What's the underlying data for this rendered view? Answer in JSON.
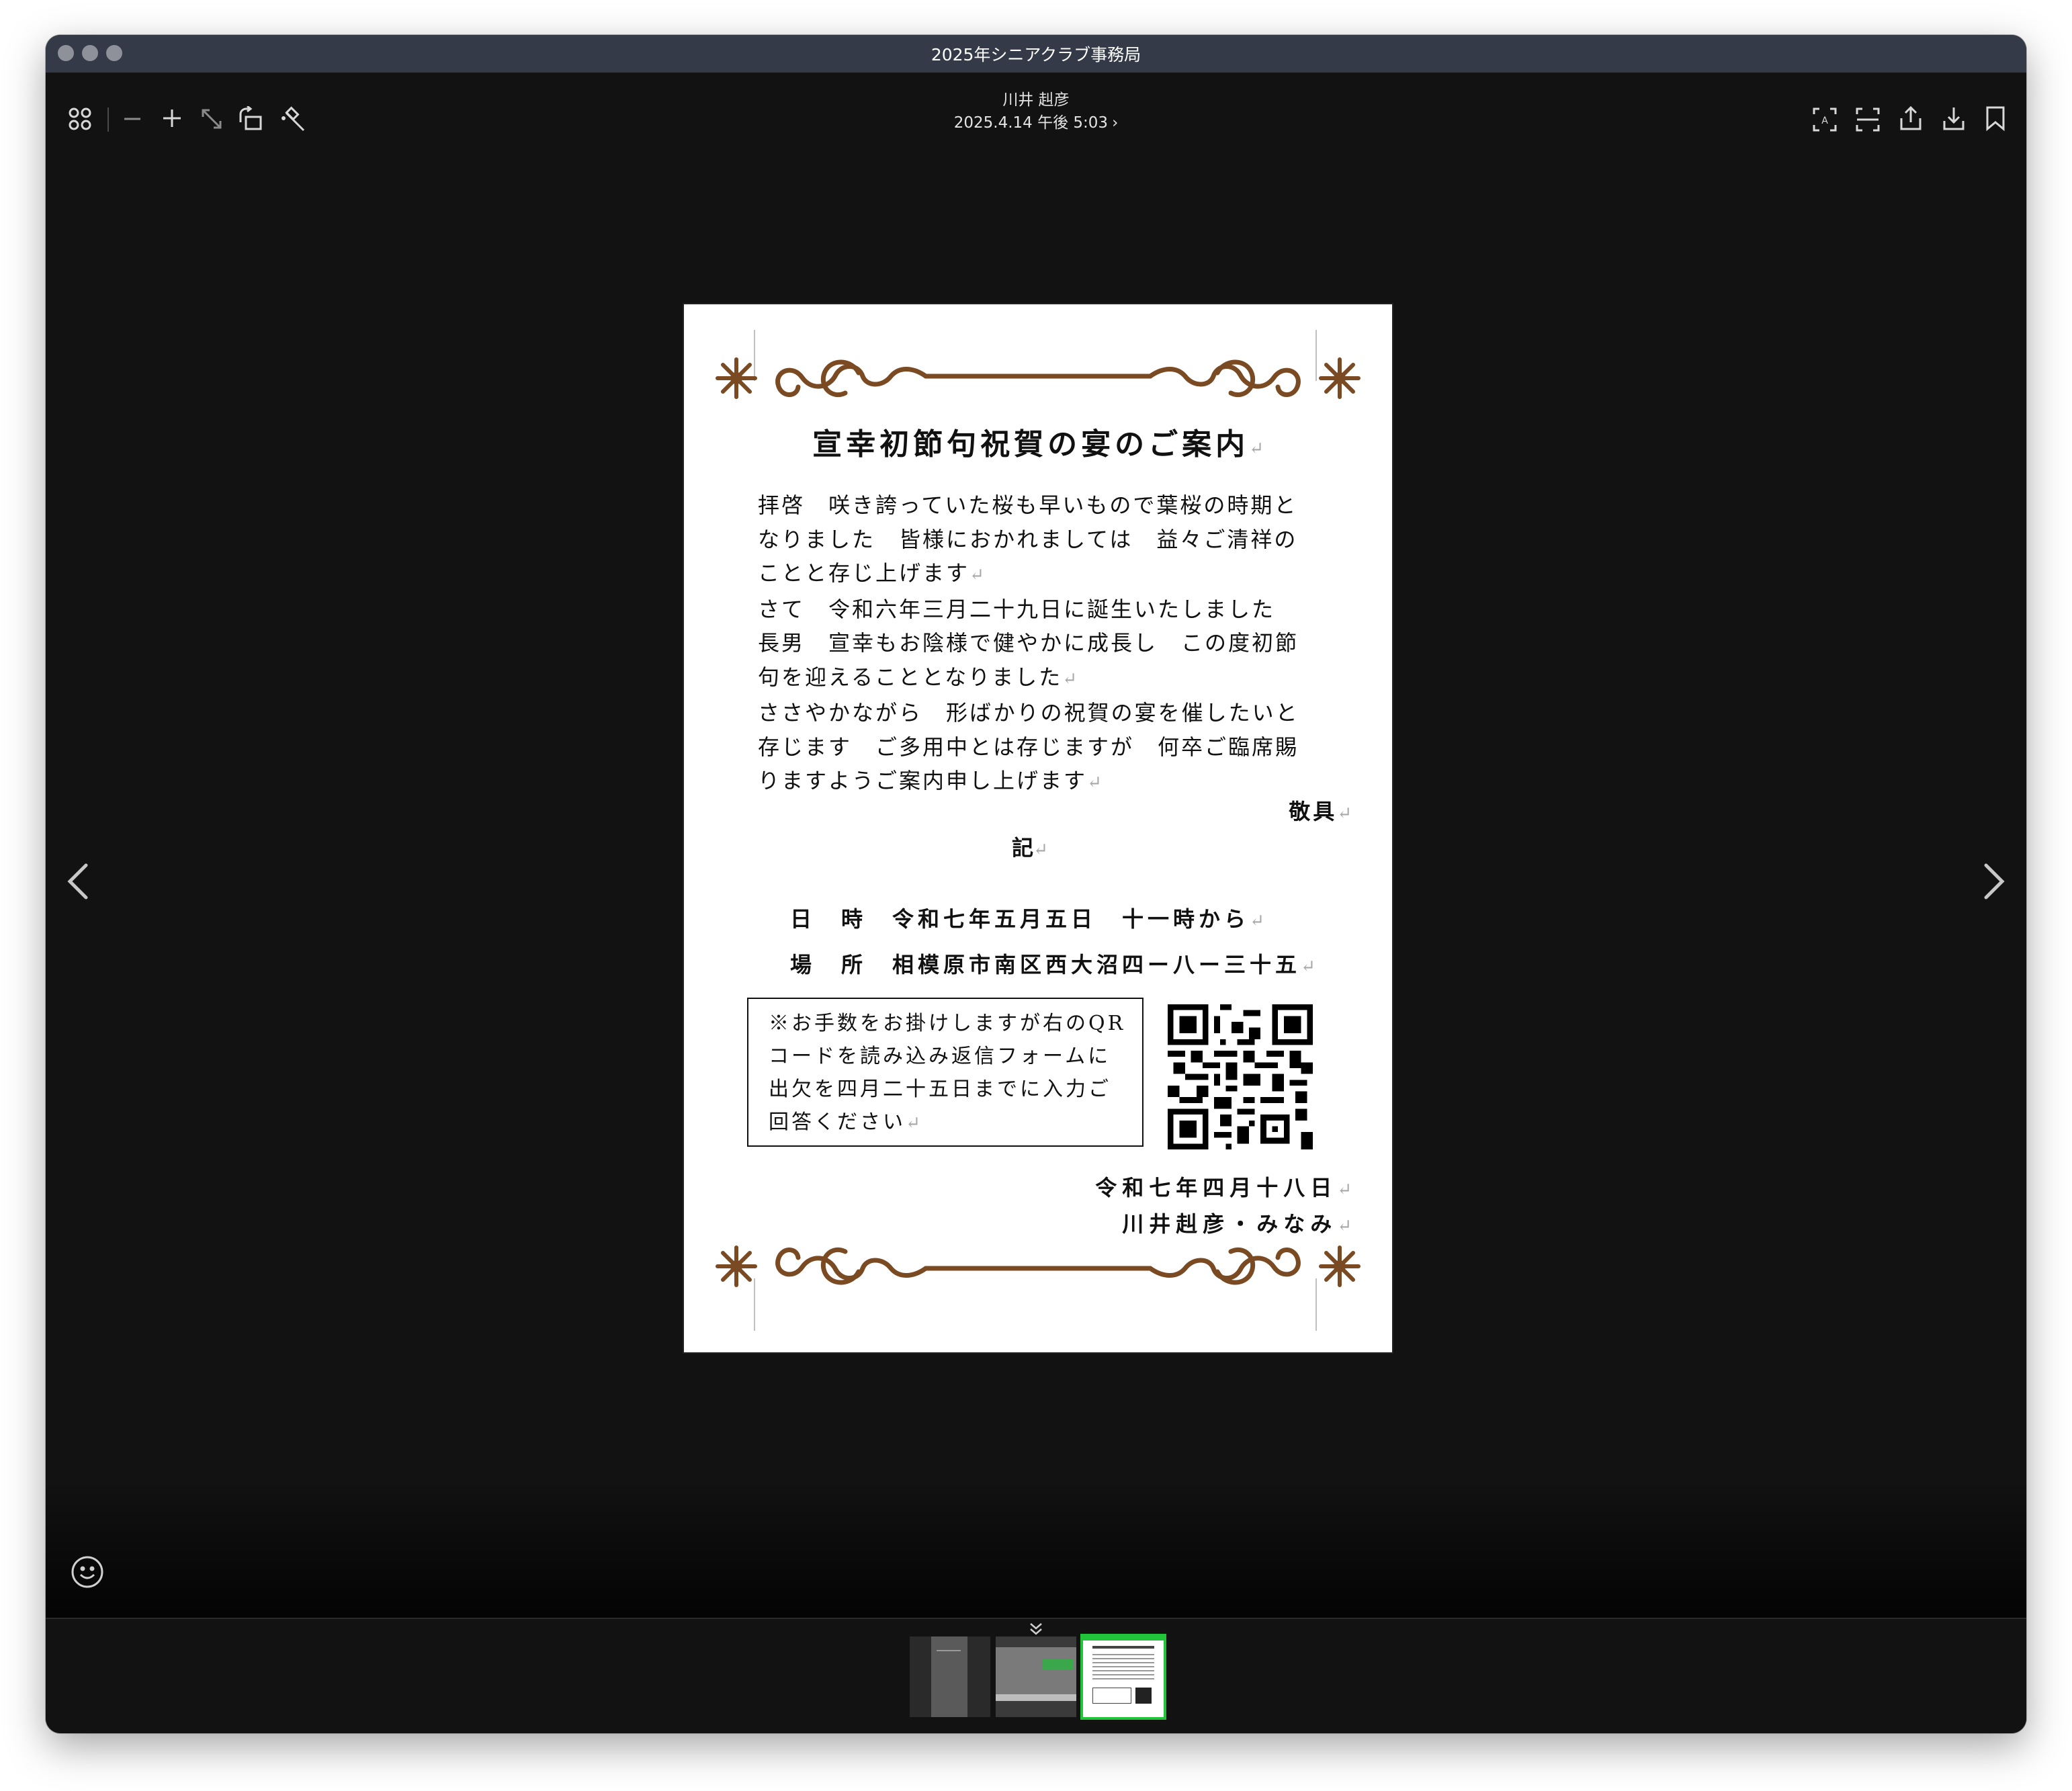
{
  "window": {
    "title": "2025年シニアクラブ事務局"
  },
  "viewer": {
    "sender_name": "川井 赳彦",
    "sent_at": "2025.4.14 午後 5:03"
  },
  "toolbar": {
    "left_icons": [
      "grid-icon",
      "zoom-out-icon",
      "zoom-in-icon",
      "fit-icon",
      "rotate-icon",
      "edit-icon"
    ],
    "right_icons": [
      "text-recognition-icon",
      "scan-icon",
      "share-icon",
      "download-icon",
      "bookmark-icon"
    ]
  },
  "document": {
    "title": "宣幸初節句祝賀の宴のご案内",
    "paragraphs": [
      "拝啓　咲き誇っていた桜も早いもので葉桜の時期となりました　皆様におかれましては　益々ご清祥のことと存じ上げます",
      "さて　令和六年三月二十九日に誕生いたしました　長男　宣幸もお陰様で健やかに成長し　この度初節句を迎えることとなりました",
      "ささやかながら　形ばかりの祝賀の宴を催したいと存じます　ご多用中とは存じますが　何卒ご臨席賜りますようご案内申し上げます"
    ],
    "closing": "敬具",
    "ki": "記",
    "datetime": "日　時　令和七年五月五日　十一時から",
    "place": "場　所　相模原市南区西大沼四ー八ー三十五",
    "notice": "※お手数をお掛けしますが右のQRコードを読み込み返信フォームに出欠を四月二十五日までに入力ご回答ください",
    "date_signed": "令和七年四月十八日",
    "signers": "川井赳彦・みなみ"
  },
  "thumbnails": [
    "thumb-1",
    "thumb-2",
    "thumb-3"
  ],
  "colors": {
    "accent_selected": "#22c43a",
    "ornament": "#7a4a22"
  }
}
